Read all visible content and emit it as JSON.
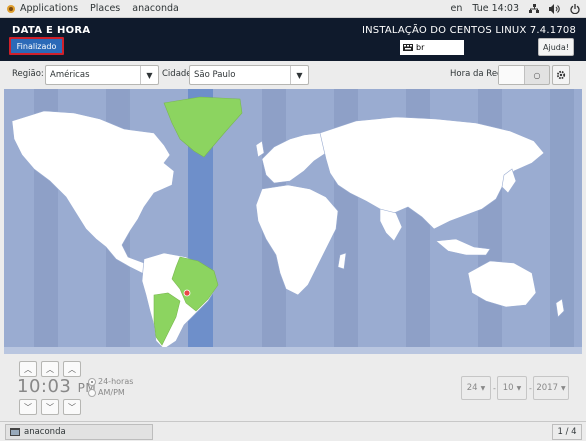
{
  "topbar": {
    "applications": "Applications",
    "places": "Places",
    "app_name": "anaconda",
    "language": "en",
    "datetime": "Tue 14:03"
  },
  "header": {
    "spoke_title": "DATA E HORA",
    "done_label": "Finalizado",
    "product": "INSTALAÇÃO DO CENTOS LINUX 7.4.1708",
    "keyboard_layout": "br",
    "help_label": "Ajuda!"
  },
  "controls": {
    "region_label": "Região:",
    "region_value": "Américas",
    "city_label": "Cidade:",
    "city_value": "São Paulo",
    "network_time_label": "Hora da Rede"
  },
  "time": {
    "hour_minute": "10:03",
    "ampm": "PM",
    "format_24h": "24-horas",
    "format_ampm": "AM/PM",
    "day": "24",
    "month": "10",
    "year": "2017"
  },
  "taskbar": {
    "task_label": "anaconda",
    "workspace": "1 / 4"
  },
  "colors": {
    "header_bg": "#0f1a2c",
    "done_button": "#2b6ab8",
    "ocean": "#9aacd1",
    "land": "#ffffff",
    "highlight_country": "#8cd460",
    "timezone_band": "#6e8fca"
  }
}
